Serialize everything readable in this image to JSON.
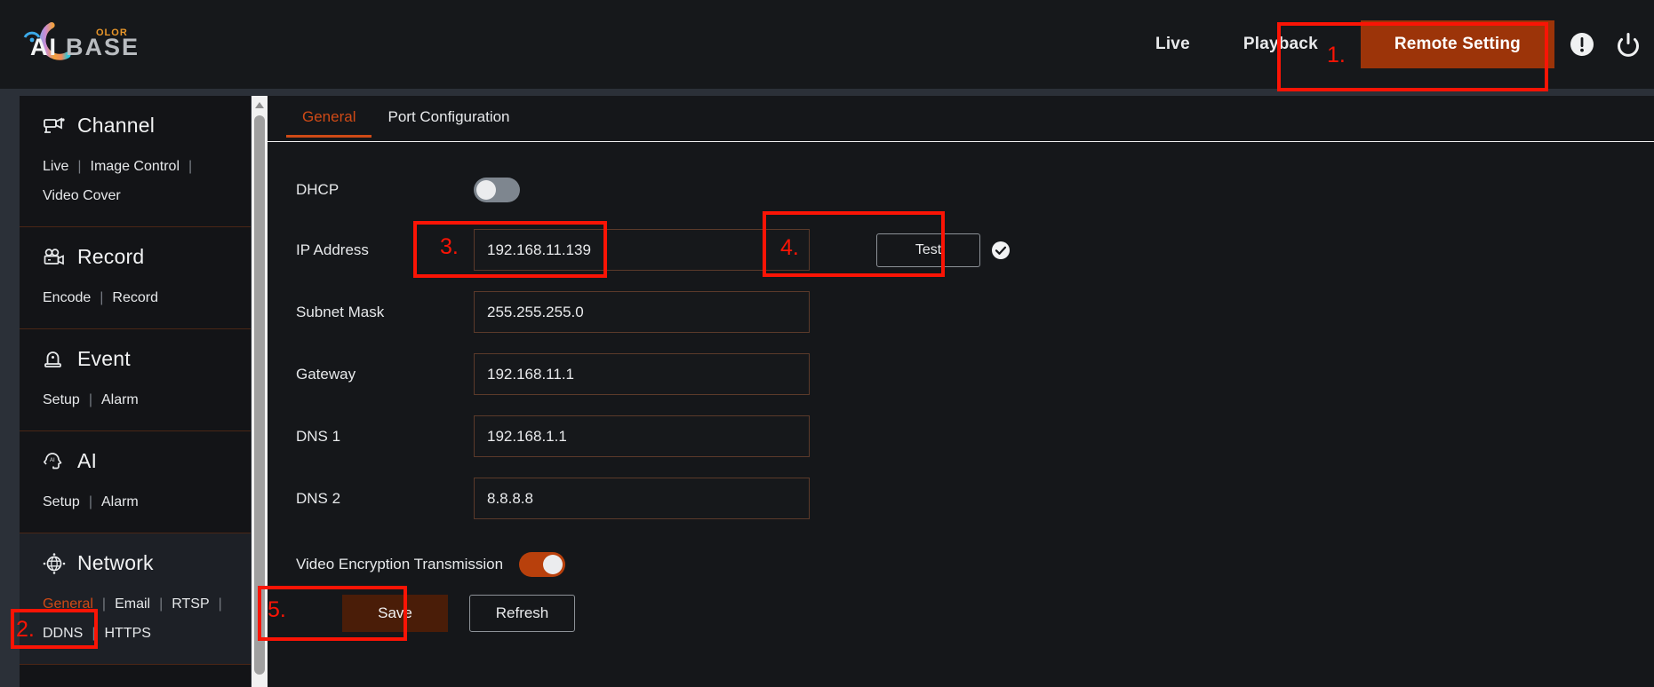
{
  "header": {
    "logo": {
      "main_text": "AIBASE",
      "sup_text": "OLOR",
      "icon_name": "aibase-colorful-logo"
    },
    "nav": [
      {
        "label": "Live",
        "name": "nav-live",
        "active": false
      },
      {
        "label": "Playback",
        "name": "nav-playback",
        "active": false
      }
    ],
    "remote_setting_label": "Remote Setting",
    "alert_icon": "exclamation-circle-icon",
    "power_icon": "power-icon",
    "accent_color": "#9c3409"
  },
  "annotations": [
    {
      "num": "1.",
      "target": "remote-setting-button"
    },
    {
      "num": "2.",
      "target": "sidebar-network-general"
    },
    {
      "num": "3.",
      "target": "ip-address-input"
    },
    {
      "num": "4.",
      "target": "test-button"
    },
    {
      "num": "5.",
      "target": "save-button"
    }
  ],
  "sidebar": {
    "groups": [
      {
        "title": "Channel",
        "icon": "camera-icon",
        "active": false,
        "links": [
          {
            "label": "Live",
            "current": false
          },
          {
            "label": "Image Control",
            "current": false
          },
          {
            "label": "Video Cover",
            "current": false
          }
        ]
      },
      {
        "title": "Record",
        "icon": "video-camera-icon",
        "active": false,
        "links": [
          {
            "label": "Encode",
            "current": false
          },
          {
            "label": "Record",
            "current": false
          }
        ]
      },
      {
        "title": "Event",
        "icon": "alarm-siren-icon",
        "active": false,
        "links": [
          {
            "label": "Setup",
            "current": false
          },
          {
            "label": "Alarm",
            "current": false
          }
        ]
      },
      {
        "title": "AI",
        "icon": "ai-head-icon",
        "active": false,
        "links": [
          {
            "label": "Setup",
            "current": false
          },
          {
            "label": "Alarm",
            "current": false
          }
        ]
      },
      {
        "title": "Network",
        "icon": "globe-network-icon",
        "active": true,
        "links": [
          {
            "label": "General",
            "current": true
          },
          {
            "label": "Email",
            "current": false
          },
          {
            "label": "RTSP",
            "current": false
          },
          {
            "label": "DDNS",
            "current": false
          },
          {
            "label": "HTTPS",
            "current": false
          }
        ]
      }
    ],
    "separator": "|"
  },
  "scrollbar": {
    "up_arrow_icon": "scroll-up-arrow-icon",
    "thumb_name": "vertical-scroll-thumb"
  },
  "content": {
    "tabs": [
      {
        "label": "General",
        "active": true
      },
      {
        "label": "Port Configuration",
        "active": false
      }
    ],
    "fields": {
      "dhcp": {
        "label": "DHCP",
        "state": "off"
      },
      "ip_address": {
        "label": "IP Address",
        "value": "192.168.11.139"
      },
      "subnet_mask": {
        "label": "Subnet Mask",
        "value": "255.255.255.0"
      },
      "gateway": {
        "label": "Gateway",
        "value": "192.168.11.1"
      },
      "dns1": {
        "label": "DNS 1",
        "value": "192.168.1.1"
      },
      "dns2": {
        "label": "DNS 2",
        "value": "8.8.8.8"
      },
      "video_encryption": {
        "label": "Video Encryption Transmission",
        "state": "on"
      }
    },
    "test_button_label": "Test",
    "test_status_icon": "check-circle-icon",
    "save_button_label": "Save",
    "refresh_button_label": "Refresh"
  }
}
